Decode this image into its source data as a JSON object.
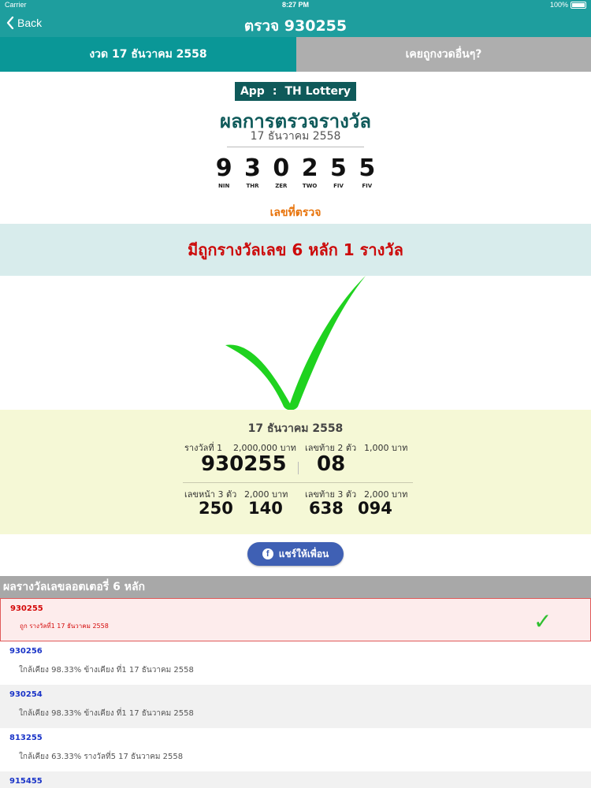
{
  "status_bar": {
    "carrier": "Carrier",
    "time": "8:27 PM",
    "battery": "100%"
  },
  "nav": {
    "back_label": "Back",
    "title": "ตรวจ 930255"
  },
  "tabs": [
    {
      "label": "งวด 17 ธันวาคม 2558",
      "selected": true
    },
    {
      "label": "เคยถูกงวดอื่นๆ?",
      "selected": false
    }
  ],
  "header": {
    "app_label": "App",
    "app_sep": ":",
    "app_name": "TH Lottery",
    "title": "ผลการตรวจรางวัล",
    "date": "17 ธันวาคม 2558",
    "digits": [
      {
        "num": "9",
        "word": "NIN"
      },
      {
        "num": "3",
        "word": "THR"
      },
      {
        "num": "0",
        "word": "ZER"
      },
      {
        "num": "2",
        "word": "TWO"
      },
      {
        "num": "5",
        "word": "FIV"
      },
      {
        "num": "5",
        "word": "FIV"
      }
    ],
    "caption": "เลขที่ตรวจ"
  },
  "banner": {
    "text": "มีถูกรางวัลเลข 6 หลัก 1 รางวัล"
  },
  "summary": {
    "date": "17 ธันวาคม 2558",
    "first_prize_label": "รางวัลที่ 1",
    "first_prize_amount": "2,000,000 บาท",
    "first_prize_number": "930255",
    "last2_label": "เลขท้าย 2 ตัว",
    "last2_amount": "1,000 บาท",
    "last2_number": "08",
    "front3_label": "เลขหน้า 3 ตัว",
    "front3_amount": "2,000 บาท",
    "front3_numbers": [
      "250",
      "140"
    ],
    "last3_label": "เลขท้าย 3 ตัว",
    "last3_amount": "2,000 บาท",
    "last3_numbers": [
      "638",
      "094"
    ]
  },
  "share": {
    "label": "แชร์ให้เพื่อน",
    "icon": "f"
  },
  "results": {
    "header": "ผลรางวัลเลขลอตเตอรี่ 6 หลัก",
    "items": [
      {
        "number": "930255",
        "desc": "ถูก รางวัลที่1 17 ธันวาคม 2558",
        "winner": true,
        "check": "✓"
      },
      {
        "number": "930256",
        "desc": "ใกล้เคียง 98.33% ข้างเคียง ที่1 17 ธันวาคม 2558"
      },
      {
        "number": "930254",
        "desc": "ใกล้เคียง 98.33% ข้างเคียง ที่1 17 ธันวาคม 2558"
      },
      {
        "number": "813255",
        "desc": "ใกล้เคียง 63.33% รางวัลที่5 17 ธันวาคม 2558"
      },
      {
        "number": "915455",
        "desc": ""
      }
    ]
  },
  "colors": {
    "teal": "#1e9e9e",
    "dark_teal": "#0f5a5a",
    "red": "#cc0a0a",
    "green": "#1fd21f",
    "blue": "#1a34c8"
  }
}
